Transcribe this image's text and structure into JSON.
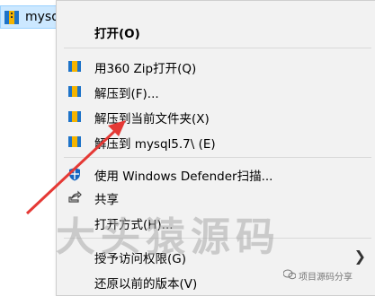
{
  "explorer": {
    "file_name": "mysq"
  },
  "menu": {
    "items": [
      {
        "label": "打开(O)",
        "icon": ""
      },
      {
        "label": "用360 Zip打开(Q)",
        "icon": "zip-archive-icon"
      },
      {
        "label": "解压到(F)...",
        "icon": "zip-archive-icon"
      },
      {
        "label": "解压到当前文件夹(X)",
        "icon": "zip-archive-icon"
      },
      {
        "label": "解压到 mysql5.7\\ (E)",
        "icon": "zip-archive-icon"
      },
      {
        "label": "使用 Windows Defender扫描...",
        "icon": "windows-defender-icon"
      },
      {
        "label": "共享",
        "icon": "share-icon"
      },
      {
        "label": "打开方式(H)...",
        "icon": ""
      },
      {
        "label": "授予访问权限(G)",
        "icon": "",
        "submenu": true
      },
      {
        "label": "还原以前的版本(V)",
        "icon": ""
      }
    ]
  },
  "watermark": {
    "text": "大头猿源码",
    "wechat_label": "项目源码分享"
  },
  "colors": {
    "arrow": "#e53935",
    "selection": "#cce8ff",
    "menu_bg": "#f2f2f2"
  }
}
